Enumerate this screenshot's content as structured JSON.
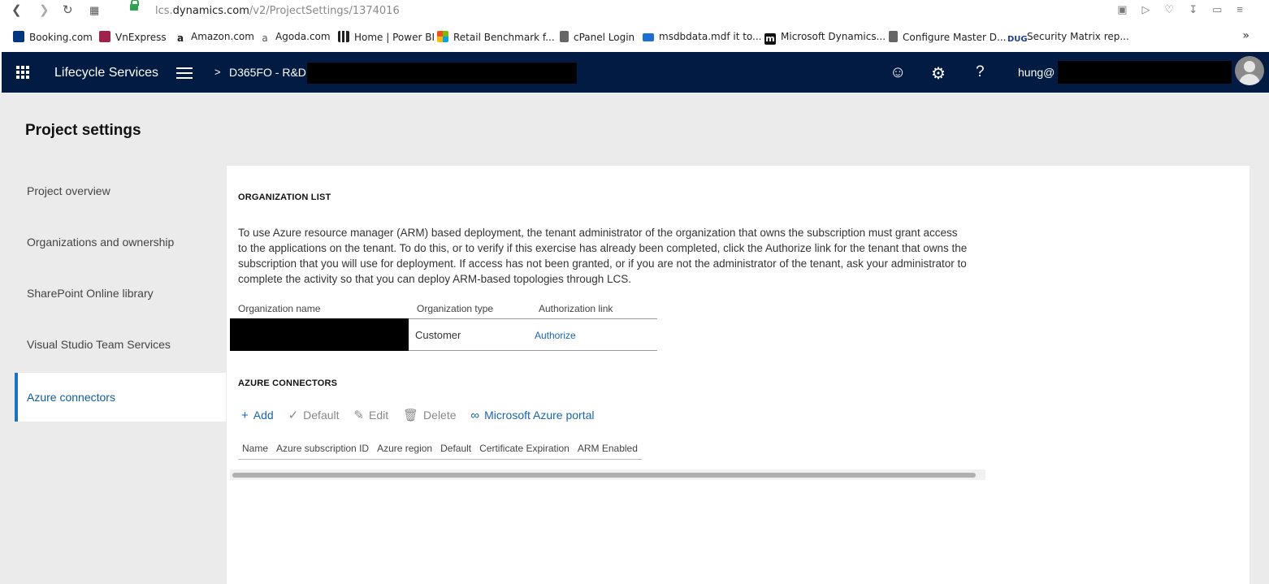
{
  "browser": {
    "url_host_prefix": "lcs.",
    "url_host_main": "dynamics.com",
    "url_path": "/v2/ProjectSettings/1374016",
    "bookmarks": [
      {
        "label": "Booking.com",
        "color": "#003580"
      },
      {
        "label": "VnExpress",
        "color": "#9f224e"
      },
      {
        "label": "Amazon.com",
        "color": "#222222"
      },
      {
        "label": "Agoda.com",
        "color": "#555555"
      },
      {
        "label": "Home | Power BI",
        "color": "#222222"
      },
      {
        "label": "Retail Benchmark f...",
        "color": "#f25022"
      },
      {
        "label": "cPanel Login",
        "color": "#555555"
      },
      {
        "label": "msdbdata.mdf it to...",
        "color": "#1a6fd6"
      },
      {
        "label": "Microsoft Dynamics...",
        "color": "#111111"
      },
      {
        "label": "Configure Master D...",
        "color": "#555555"
      },
      {
        "label": "Security Matrix rep...",
        "color": "#1a3e9a"
      }
    ]
  },
  "header": {
    "app_title": "Lifecycle Services",
    "crumb_separator": ">",
    "project_name": "D365FO - R&D",
    "user_name": "hung@",
    "bg_color": "#021b43"
  },
  "page": {
    "title": "Project settings"
  },
  "left_nav": [
    {
      "label": "Project overview",
      "active": false
    },
    {
      "label": "Organizations and ownership",
      "active": false
    },
    {
      "label": "SharePoint Online library",
      "active": false
    },
    {
      "label": "Visual Studio Team Services",
      "active": false
    },
    {
      "label": "Azure connectors",
      "active": true
    }
  ],
  "org_section": {
    "title": "ORGANIZATION LIST",
    "description": "To use Azure resource manager (ARM) based deployment, the tenant administrator of the organization that owns the subscription must grant access to the applications on the tenant. To do this, or to verify if this exercise has already been completed, click the Authorize link for the tenant that owns the subscription that you will use for deployment. If access has not been granted, or if you are not the administrator of the tenant, ask your administrator to complete the activity so that you can deploy ARM-based topologies through LCS.",
    "columns": [
      "Organization name",
      "Organization type",
      "Authorization link"
    ],
    "rows": [
      {
        "type": "Customer",
        "link": "Authorize"
      }
    ]
  },
  "azure_section": {
    "title": "AZURE CONNECTORS",
    "toolbar": {
      "add": "Add",
      "default": "Default",
      "edit": "Edit",
      "delete": "Delete",
      "portal": "Microsoft Azure portal"
    },
    "columns": [
      "Name",
      "Azure subscription ID",
      "Azure region",
      "Default",
      "Certificate Expiration",
      "ARM Enabled"
    ]
  }
}
